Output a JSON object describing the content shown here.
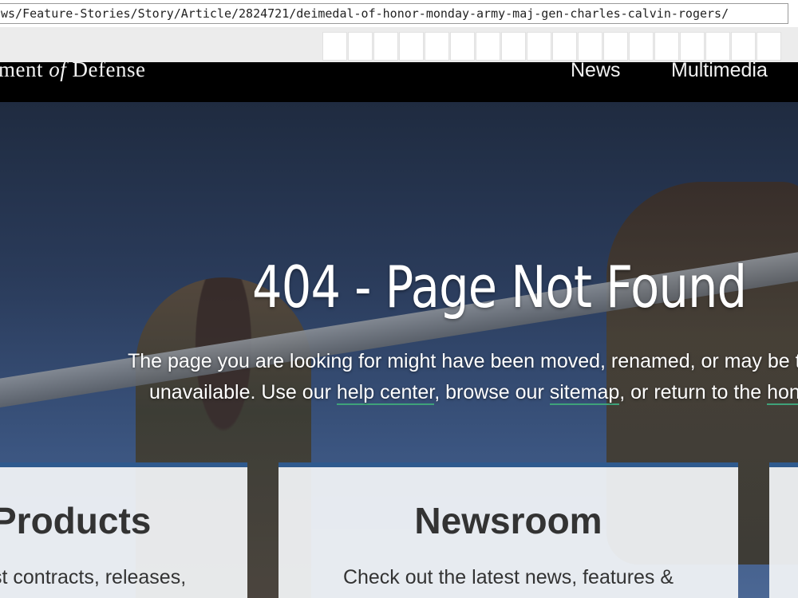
{
  "browser": {
    "url": "ws/Feature-Stories/Story/Article/2824721/deimedal-of-honor-monday-army-maj-gen-charles-calvin-rogers/"
  },
  "header": {
    "brand_prefix": "ment ",
    "brand_of": "of",
    "brand_suffix": " Defense",
    "nav": [
      "News",
      "Multimedia"
    ]
  },
  "hero": {
    "title": "404 - Page Not Found",
    "text_1": "The page you are looking for might have been moved, renamed, or may be te",
    "text_2a": "unavailable. Use our ",
    "link_help": "help center",
    "text_2b": ", browse our ",
    "link_sitemap": "sitemap",
    "text_2c": ", or return to the ",
    "link_home": "hon"
  },
  "cards": {
    "left": {
      "title": "Products",
      "text": "st contracts, releases,"
    },
    "mid": {
      "title": "Newsroom",
      "text": "Check out the latest news, features &"
    }
  },
  "colors": {
    "header_bg": "#000000",
    "card_border": "#2f5a8e",
    "link_underline": "#3fa27a"
  }
}
